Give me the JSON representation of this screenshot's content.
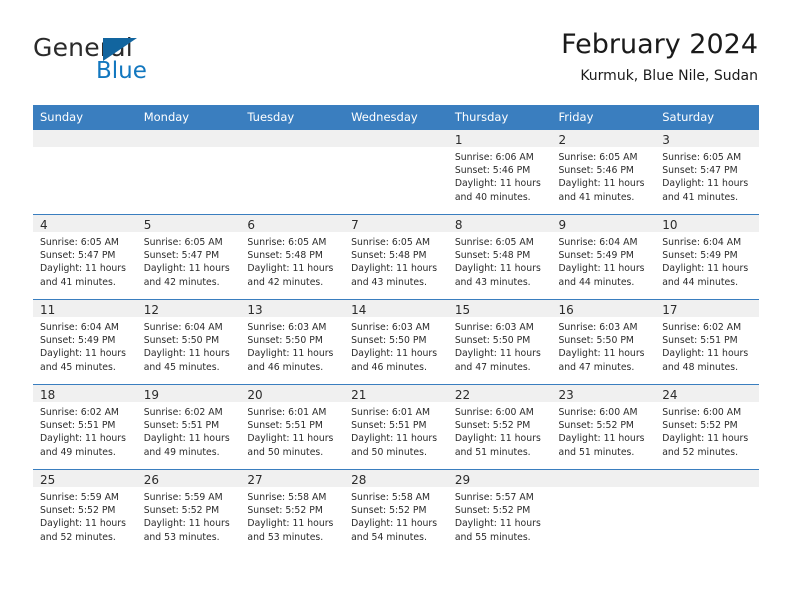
{
  "brand": {
    "name_part1": "General",
    "name_part2": "Blue",
    "triangle_color": "#12659f",
    "blue_text_color": "#1277bf"
  },
  "header": {
    "title": "February 2024",
    "subtitle": "Kurmuk, Blue Nile, Sudan"
  },
  "theme": {
    "header_bar_color": "#3a7ebf",
    "daynum_band_color": "#f0f0f0",
    "grid_line_color": "#3a7ebf"
  },
  "weekday_headers": [
    "Sunday",
    "Monday",
    "Tuesday",
    "Wednesday",
    "Thursday",
    "Friday",
    "Saturday"
  ],
  "weeks": [
    [
      {
        "day": "",
        "lines": []
      },
      {
        "day": "",
        "lines": []
      },
      {
        "day": "",
        "lines": []
      },
      {
        "day": "",
        "lines": []
      },
      {
        "day": "1",
        "lines": [
          "Sunrise: 6:06 AM",
          "Sunset: 5:46 PM",
          "Daylight: 11 hours",
          "and 40 minutes."
        ]
      },
      {
        "day": "2",
        "lines": [
          "Sunrise: 6:05 AM",
          "Sunset: 5:46 PM",
          "Daylight: 11 hours",
          "and 41 minutes."
        ]
      },
      {
        "day": "3",
        "lines": [
          "Sunrise: 6:05 AM",
          "Sunset: 5:47 PM",
          "Daylight: 11 hours",
          "and 41 minutes."
        ]
      }
    ],
    [
      {
        "day": "4",
        "lines": [
          "Sunrise: 6:05 AM",
          "Sunset: 5:47 PM",
          "Daylight: 11 hours",
          "and 41 minutes."
        ]
      },
      {
        "day": "5",
        "lines": [
          "Sunrise: 6:05 AM",
          "Sunset: 5:47 PM",
          "Daylight: 11 hours",
          "and 42 minutes."
        ]
      },
      {
        "day": "6",
        "lines": [
          "Sunrise: 6:05 AM",
          "Sunset: 5:48 PM",
          "Daylight: 11 hours",
          "and 42 minutes."
        ]
      },
      {
        "day": "7",
        "lines": [
          "Sunrise: 6:05 AM",
          "Sunset: 5:48 PM",
          "Daylight: 11 hours",
          "and 43 minutes."
        ]
      },
      {
        "day": "8",
        "lines": [
          "Sunrise: 6:05 AM",
          "Sunset: 5:48 PM",
          "Daylight: 11 hours",
          "and 43 minutes."
        ]
      },
      {
        "day": "9",
        "lines": [
          "Sunrise: 6:04 AM",
          "Sunset: 5:49 PM",
          "Daylight: 11 hours",
          "and 44 minutes."
        ]
      },
      {
        "day": "10",
        "lines": [
          "Sunrise: 6:04 AM",
          "Sunset: 5:49 PM",
          "Daylight: 11 hours",
          "and 44 minutes."
        ]
      }
    ],
    [
      {
        "day": "11",
        "lines": [
          "Sunrise: 6:04 AM",
          "Sunset: 5:49 PM",
          "Daylight: 11 hours",
          "and 45 minutes."
        ]
      },
      {
        "day": "12",
        "lines": [
          "Sunrise: 6:04 AM",
          "Sunset: 5:50 PM",
          "Daylight: 11 hours",
          "and 45 minutes."
        ]
      },
      {
        "day": "13",
        "lines": [
          "Sunrise: 6:03 AM",
          "Sunset: 5:50 PM",
          "Daylight: 11 hours",
          "and 46 minutes."
        ]
      },
      {
        "day": "14",
        "lines": [
          "Sunrise: 6:03 AM",
          "Sunset: 5:50 PM",
          "Daylight: 11 hours",
          "and 46 minutes."
        ]
      },
      {
        "day": "15",
        "lines": [
          "Sunrise: 6:03 AM",
          "Sunset: 5:50 PM",
          "Daylight: 11 hours",
          "and 47 minutes."
        ]
      },
      {
        "day": "16",
        "lines": [
          "Sunrise: 6:03 AM",
          "Sunset: 5:50 PM",
          "Daylight: 11 hours",
          "and 47 minutes."
        ]
      },
      {
        "day": "17",
        "lines": [
          "Sunrise: 6:02 AM",
          "Sunset: 5:51 PM",
          "Daylight: 11 hours",
          "and 48 minutes."
        ]
      }
    ],
    [
      {
        "day": "18",
        "lines": [
          "Sunrise: 6:02 AM",
          "Sunset: 5:51 PM",
          "Daylight: 11 hours",
          "and 49 minutes."
        ]
      },
      {
        "day": "19",
        "lines": [
          "Sunrise: 6:02 AM",
          "Sunset: 5:51 PM",
          "Daylight: 11 hours",
          "and 49 minutes."
        ]
      },
      {
        "day": "20",
        "lines": [
          "Sunrise: 6:01 AM",
          "Sunset: 5:51 PM",
          "Daylight: 11 hours",
          "and 50 minutes."
        ]
      },
      {
        "day": "21",
        "lines": [
          "Sunrise: 6:01 AM",
          "Sunset: 5:51 PM",
          "Daylight: 11 hours",
          "and 50 minutes."
        ]
      },
      {
        "day": "22",
        "lines": [
          "Sunrise: 6:00 AM",
          "Sunset: 5:52 PM",
          "Daylight: 11 hours",
          "and 51 minutes."
        ]
      },
      {
        "day": "23",
        "lines": [
          "Sunrise: 6:00 AM",
          "Sunset: 5:52 PM",
          "Daylight: 11 hours",
          "and 51 minutes."
        ]
      },
      {
        "day": "24",
        "lines": [
          "Sunrise: 6:00 AM",
          "Sunset: 5:52 PM",
          "Daylight: 11 hours",
          "and 52 minutes."
        ]
      }
    ],
    [
      {
        "day": "25",
        "lines": [
          "Sunrise: 5:59 AM",
          "Sunset: 5:52 PM",
          "Daylight: 11 hours",
          "and 52 minutes."
        ]
      },
      {
        "day": "26",
        "lines": [
          "Sunrise: 5:59 AM",
          "Sunset: 5:52 PM",
          "Daylight: 11 hours",
          "and 53 minutes."
        ]
      },
      {
        "day": "27",
        "lines": [
          "Sunrise: 5:58 AM",
          "Sunset: 5:52 PM",
          "Daylight: 11 hours",
          "and 53 minutes."
        ]
      },
      {
        "day": "28",
        "lines": [
          "Sunrise: 5:58 AM",
          "Sunset: 5:52 PM",
          "Daylight: 11 hours",
          "and 54 minutes."
        ]
      },
      {
        "day": "29",
        "lines": [
          "Sunrise: 5:57 AM",
          "Sunset: 5:52 PM",
          "Daylight: 11 hours",
          "and 55 minutes."
        ]
      },
      {
        "day": "",
        "lines": []
      },
      {
        "day": "",
        "lines": []
      }
    ]
  ]
}
